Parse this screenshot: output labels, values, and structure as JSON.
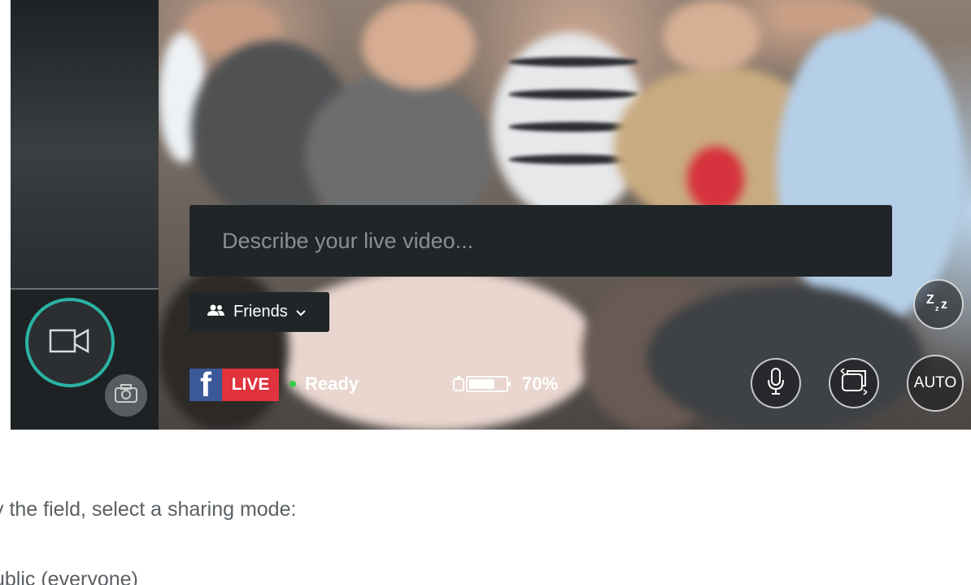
{
  "live_view": {
    "description_placeholder": "Describe your live video...",
    "audience_label": "Friends",
    "platform_badge": "LIVE",
    "status": "Ready",
    "status_color": "#33cc44",
    "battery": {
      "level_percent": 70,
      "label": "70%"
    },
    "auto_label": "AUTO",
    "icons": [
      "video-camera-icon",
      "photo-camera-icon",
      "friends-icon",
      "chevron-down-icon",
      "facebook-icon",
      "battery-icon",
      "sleep-icon",
      "microphone-icon",
      "switch-camera-icon"
    ],
    "accent_color": "#2bb3a4",
    "live_color": "#e0333d",
    "facebook_color": "#3b5998"
  },
  "article": {
    "line1": "y the field, select a sharing mode:",
    "line2": "ublic (everyone)"
  }
}
